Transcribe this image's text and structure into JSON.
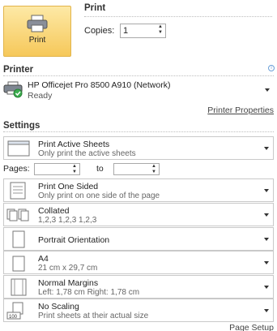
{
  "print": {
    "button_label": "Print",
    "heading": "Print",
    "copies_label": "Copies:",
    "copies_value": "1"
  },
  "printer": {
    "section_title": "Printer",
    "name": "HP Officejet Pro 8500 A910 (Network)",
    "status": "Ready",
    "properties_link": "Printer Properties"
  },
  "settings": {
    "section_title": "Settings",
    "active_sheets": {
      "title": "Print Active Sheets",
      "sub": "Only print the active sheets"
    },
    "pages": {
      "label": "Pages:",
      "to_label": "to",
      "from_value": "",
      "to_value": ""
    },
    "sided": {
      "title": "Print One Sided",
      "sub": "Only print on one side of the page"
    },
    "collated": {
      "title": "Collated",
      "sub": "1,2,3   1,2,3   1,2,3"
    },
    "orientation": {
      "title": "Portrait Orientation"
    },
    "paper": {
      "title": "A4",
      "sub": "21 cm x 29,7 cm"
    },
    "margins": {
      "title": "Normal Margins",
      "sub": "Left: 1,78 cm   Right: 1,78 cm"
    },
    "scaling": {
      "title": "No Scaling",
      "sub": "Print sheets at their actual size",
      "icon_text": "100"
    },
    "page_setup_link": "Page Setup"
  }
}
